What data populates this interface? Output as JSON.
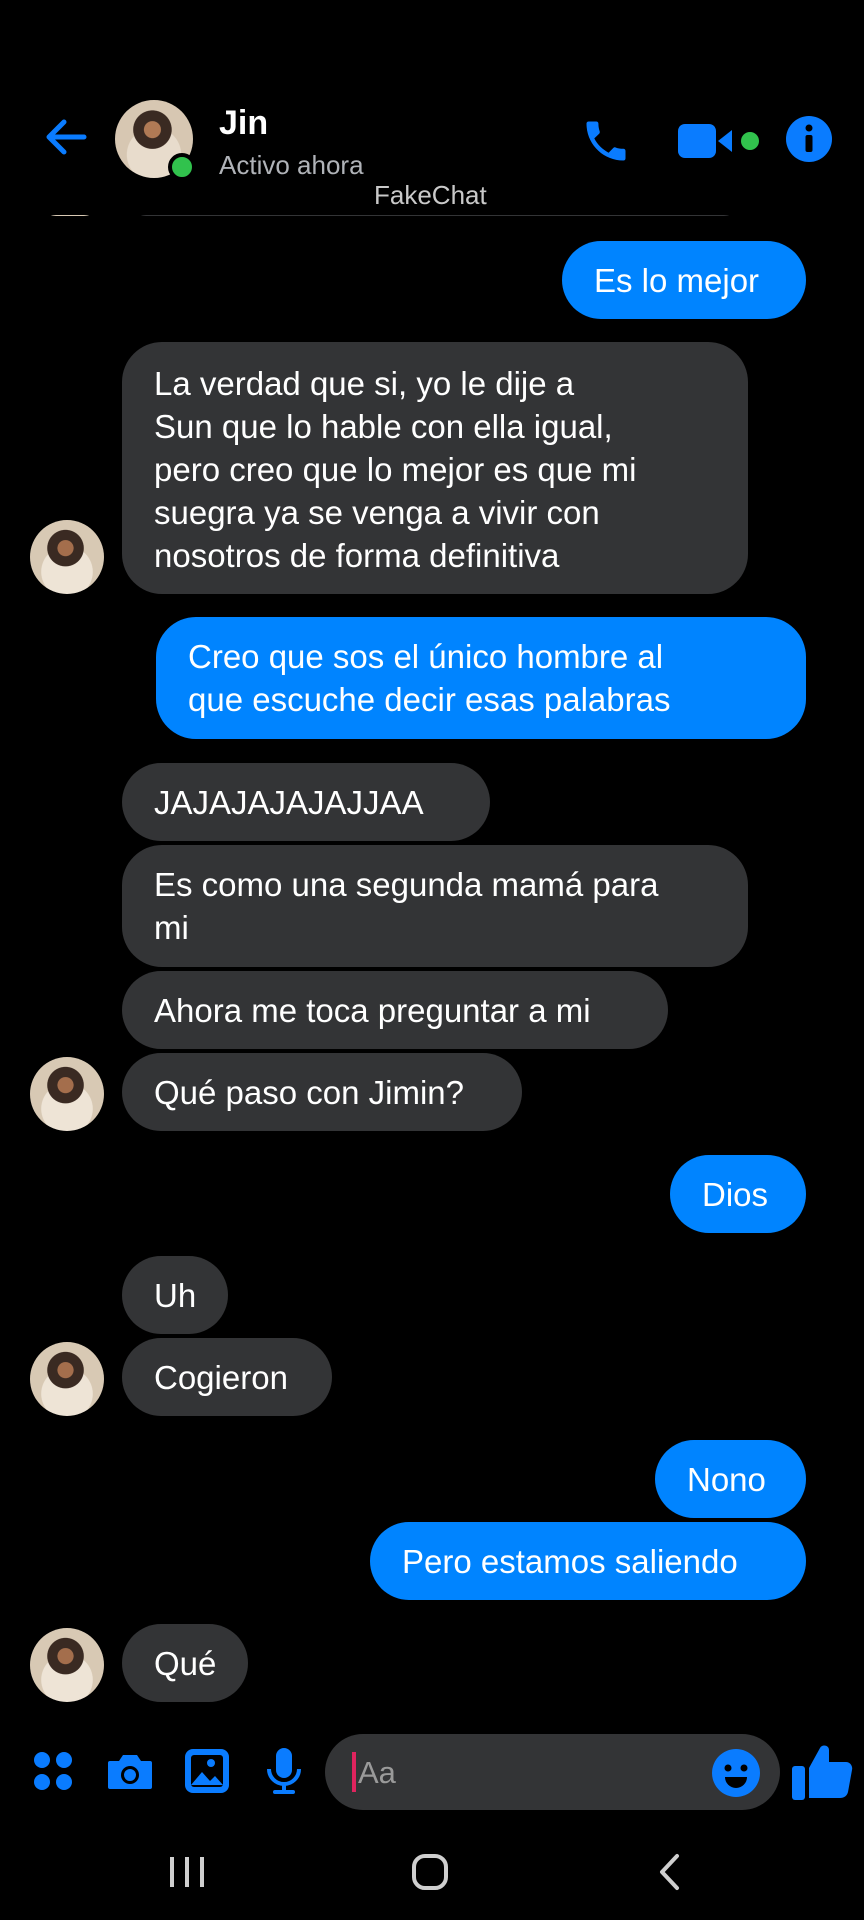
{
  "header": {
    "contact_name": "Jin",
    "status": "Activo ahora",
    "watermark": "FakeChat"
  },
  "messages": [
    {
      "side": "sent",
      "text": "Es lo mejor"
    },
    {
      "side": "received",
      "text": "La verdad que si, yo le dije a\nSun que lo hable con ella igual,\npero creo que lo mejor es que mi\nsuegra ya se venga a vivir con\nnosotros de forma definitiva"
    },
    {
      "side": "sent",
      "text": "Creo que sos el único hombre al\nque escuche decir esas palabras"
    },
    {
      "side": "received",
      "text": "JAJAJAJAJAJJAA"
    },
    {
      "side": "received",
      "text": "Es como una segunda mamá para\nmi"
    },
    {
      "side": "received",
      "text": "Ahora me toca preguntar a mi"
    },
    {
      "side": "received",
      "text": "Qué paso con Jimin?"
    },
    {
      "side": "sent",
      "text": "Dios"
    },
    {
      "side": "received",
      "text": "Uh"
    },
    {
      "side": "received",
      "text": "Cogieron"
    },
    {
      "side": "sent",
      "text": "Nono"
    },
    {
      "side": "sent",
      "text": "Pero estamos saliendo"
    },
    {
      "side": "received",
      "text": "Qué"
    }
  ],
  "composer": {
    "placeholder": "Aa",
    "icons": [
      "apps-icon",
      "camera-icon",
      "gallery-icon",
      "microphone-icon",
      "emoji-icon",
      "thumbs-up-icon"
    ]
  },
  "colors": {
    "background": "#000000",
    "sent_bubble": "#0084ff",
    "received_bubble": "#333436",
    "accent": "#0084ff",
    "presence": "#31c24d"
  }
}
